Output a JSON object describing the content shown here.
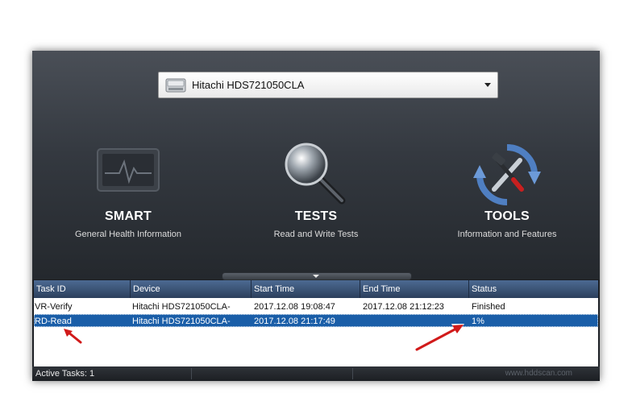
{
  "device_selector": {
    "selected": "Hitachi HDS721050CLA"
  },
  "tiles": [
    {
      "title": "SMART",
      "subtitle": "General Health Information",
      "icon": "monitor-heartbeat-icon"
    },
    {
      "title": "TESTS",
      "subtitle": "Read and Write Tests",
      "icon": "magnifier-icon"
    },
    {
      "title": "TOOLS",
      "subtitle": "Information and Features",
      "icon": "tools-refresh-icon"
    }
  ],
  "table": {
    "columns": [
      "Task ID",
      "Device",
      "Start Time",
      "End Time",
      "Status"
    ],
    "rows": [
      {
        "task_id": "VR-Verify",
        "device": "Hitachi HDS721050CLA-",
        "start": "2017.12.08 19:08:47",
        "end": "2017.12.08 21:12:23",
        "status": "Finished"
      },
      {
        "task_id": "RD-Read",
        "device": "Hitachi HDS721050CLA-",
        "start": "2017.12.08 21:17:49",
        "end": "",
        "status": "1%"
      }
    ]
  },
  "statusbar": {
    "active_tasks": "Active Tasks: 1",
    "watermark": "www.hddscan.com"
  },
  "colors": {
    "selected_row": "#1a5ea8",
    "header": "#2c3f5c",
    "annotation_arrow": "#d11a1a"
  }
}
